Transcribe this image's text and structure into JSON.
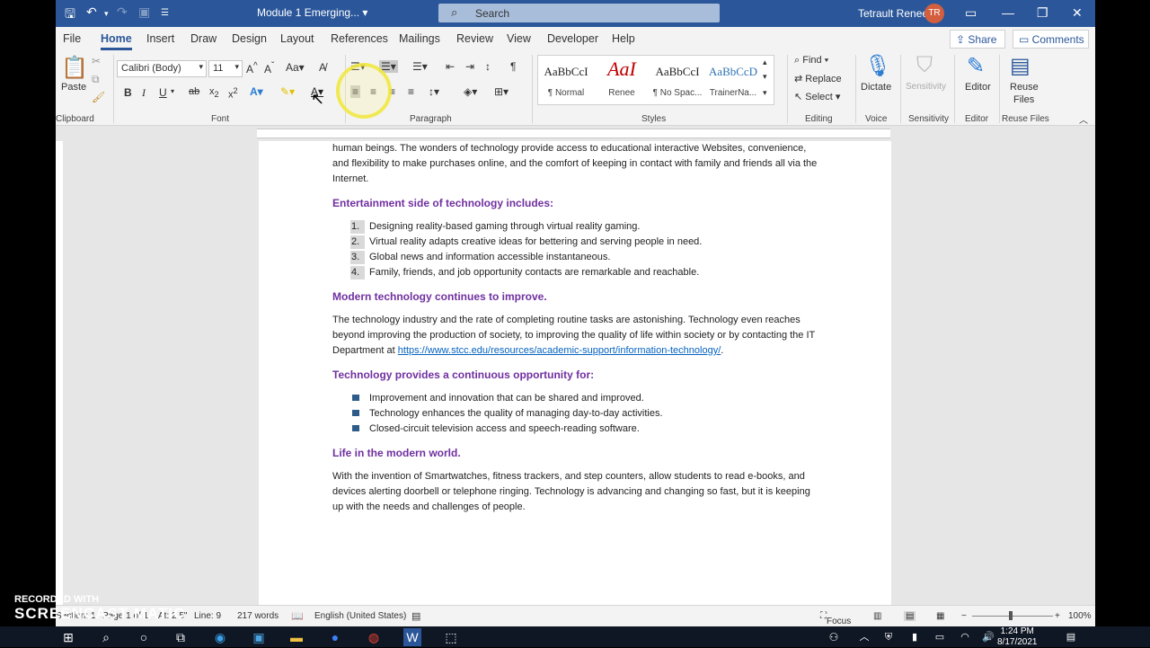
{
  "titlebar": {
    "doc_title": "Module 1 Emerging...",
    "search_placeholder": "Search",
    "user_name": "Tetrault Renee",
    "user_initials": "TR"
  },
  "tabs": [
    "File",
    "Home",
    "Insert",
    "Draw",
    "Design",
    "Layout",
    "References",
    "Mailings",
    "Review",
    "View",
    "Developer",
    "Help"
  ],
  "active_tab": "Home",
  "share_label": "Share",
  "comments_label": "Comments",
  "ribbon": {
    "clipboard": {
      "paste": "Paste",
      "label": "Clipboard"
    },
    "font": {
      "name": "Calibri (Body)",
      "size": "11",
      "label": "Font"
    },
    "paragraph": {
      "label": "Paragraph"
    },
    "styles": {
      "label": "Styles",
      "items": [
        {
          "sample": "AaBbCcI",
          "name": "¶ Normal"
        },
        {
          "sample": "AaI",
          "name": "Renee"
        },
        {
          "sample": "AaBbCcI",
          "name": "¶ No Spac..."
        },
        {
          "sample": "AaBbCcD",
          "name": "TrainerNa..."
        }
      ]
    },
    "editing": {
      "find": "Find",
      "replace": "Replace",
      "select": "Select",
      "label": "Editing"
    },
    "voice": {
      "dictate": "Dictate",
      "label": "Voice"
    },
    "sensitivity": {
      "btn": "Sensitivity",
      "label": "Sensitivity"
    },
    "editor": {
      "btn": "Editor",
      "label": "Editor"
    },
    "reuse": {
      "btn1": "Reuse",
      "btn2": "Files",
      "label": "Reuse Files"
    }
  },
  "document": {
    "intro": "human beings. The wonders of technology provide access to educational interactive Websites, convenience, and flexibility to make purchases online, and the comfort of keeping in contact with family and friends all via the Internet.",
    "h1": "Entertainment side of technology includes:",
    "list1": [
      {
        "n": "1.",
        "text": "Designing reality-based gaming through virtual reality gaming."
      },
      {
        "n": "2.",
        "text": "Virtual reality adapts creative ideas for bettering and serving people in need."
      },
      {
        "n": "3.",
        "text": "Global news and information accessible instantaneous."
      },
      {
        "n": "4.",
        "text": "Family, friends, and job opportunity contacts are remarkable and reachable."
      }
    ],
    "h2": "Modern technology continues to improve.",
    "para2_pre": "The technology industry and the rate of completing routine tasks are astonishing. Technology even reaches beyond improving the production of society, to improving the quality of life within society or by contacting the IT Department at ",
    "para2_link": "https://www.stcc.edu/resources/academic-support/information-technology/",
    "para2_post": ".",
    "h3": "Technology provides a continuous opportunity for:",
    "list2": [
      "Improvement and innovation that can be shared and improved.",
      "Technology enhances the quality of managing day-to-day activities.",
      "Closed-circuit television access and speech-reading software."
    ],
    "h4": "Life in the modern world.",
    "para4": "With the invention of Smartwatches, fitness trackers, and step counters, allow students to read e-books, and devices alerting doorbell or telephone ringing. Technology is advancing and changing so fast, but it is keeping up with the needs and challenges of people."
  },
  "statusbar": {
    "section": "Section: 1",
    "page": "Page 1 of 1",
    "at": "At: 2.5\"",
    "lines": "Line: 9",
    "words": "217 words",
    "language": "English (United States)",
    "focus": "Focus",
    "zoom": "100%"
  },
  "taskbar": {
    "time": "1:24 PM",
    "date": "8/17/2021"
  },
  "watermark": {
    "recorded": "RECORDED WITH",
    "brand": "SCREENCAST MATIC"
  }
}
